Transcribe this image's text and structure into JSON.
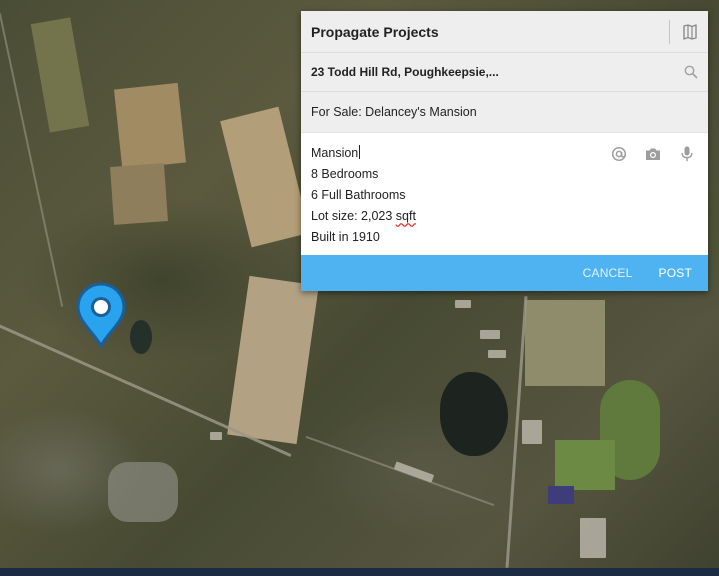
{
  "card": {
    "title": "Propagate Projects",
    "address": "23 Todd Hill Rd, Poughkeepsie,...",
    "subject": "For Sale: Delancey's Mansion",
    "body": {
      "line1": "Mansion",
      "line2": "8 Bedrooms",
      "line3": "6 Full Bathrooms",
      "line4_prefix": "Lot size: 2,023 ",
      "line4_flagged": "sqft",
      "line5": "Built in 1910"
    },
    "actions": {
      "cancel": "CANCEL",
      "post": "POST"
    }
  },
  "icons": {
    "header": "map-icon",
    "address": "search-icon",
    "tools": [
      "at-icon",
      "camera-icon",
      "microphone-icon"
    ],
    "map": "location-pin-icon"
  },
  "colors": {
    "accent": "#4fb3f2",
    "pin": "#29a3ee",
    "bottom_bar": "#1c2b44",
    "header_bg": "#eeeeee"
  }
}
